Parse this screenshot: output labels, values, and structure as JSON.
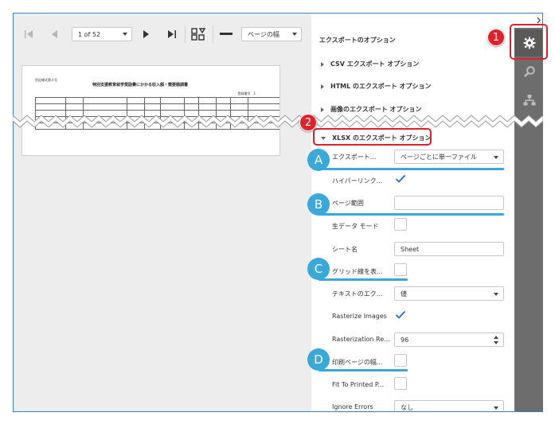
{
  "toolbar": {
    "page_indicator": "1 of 52",
    "zoom_value": "ページの幅"
  },
  "document": {
    "code": "別記様式第４号",
    "title": "特別支援教育就学奨励費にかかる収入額・需要額調書",
    "reg_label": "登録番号",
    "reg_value": "1"
  },
  "panel": {
    "title": "エクスポートのオプション",
    "sections": {
      "csv": "CSV エクスポート オプション",
      "html": "HTML のエクスポート オプション",
      "image": "画像のエクスポート オプション",
      "xlsx": "XLSX のエクスポート オプション"
    },
    "rows": {
      "export_mode_label": "エクスポート...",
      "export_mode_value": "ページごとに単一ファイル",
      "hyperlink_label": "ハイパーリンク...",
      "page_range_label": "ページ範囲",
      "page_range_value": "",
      "raw_data_label": "生データ モード",
      "sheet_name_label": "シート名",
      "sheet_name_value": "Sheet",
      "grid_lines_label": "グリッド線を表...",
      "text_export_label": "テキストのエク...",
      "text_export_value": "値",
      "rasterize_label": "Rasterize Images",
      "resolution_label": "Rasterization Re...",
      "resolution_value": "96",
      "print_page_label": "印刷ページの幅...",
      "fit_label": "Fit To Printed P...",
      "ignore_label": "Ignore Errors",
      "ignore_value": "なし"
    }
  },
  "callouts": {
    "one": "1",
    "two": "2",
    "a": "A",
    "b": "B",
    "c": "C",
    "d": "D"
  },
  "colors": {
    "callout_red": "#e0202a",
    "badge_blue": "#3aa8d8",
    "sidebar_gray": "#6d6d6d",
    "check_blue": "#1f6fd0"
  }
}
